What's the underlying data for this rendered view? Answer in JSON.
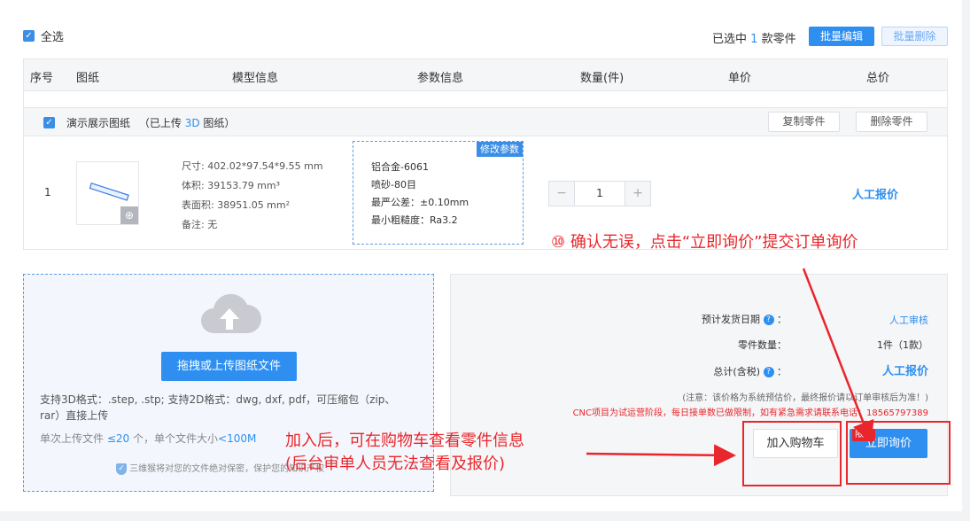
{
  "toolbar": {
    "select_all": "全选",
    "selected_prefix": "已选中",
    "selected_count": "1",
    "selected_suffix": "款零件",
    "batch_edit": "批量编辑",
    "batch_delete": "批量删除"
  },
  "table": {
    "headers": [
      "序号",
      "图纸",
      "模型信息",
      "参数信息",
      "数量(件)",
      "单价",
      "总价"
    ]
  },
  "group": {
    "name": "演示展示图纸",
    "uploaded_prefix": "（已上传",
    "uploaded_count": "3D",
    "uploaded_suffix": "图纸）",
    "copy_part": "复制零件",
    "delete_part": "删除零件"
  },
  "part": {
    "index": "1",
    "size": "尺寸: 402.02*97.54*9.55 mm",
    "volume": "体积: 39153.79 mm³",
    "area": "表面积: 38951.05 mm²",
    "note": "备注: 无",
    "edit_params": "修改参数",
    "material": "铝合金-6061",
    "finish": "喷砂-80目",
    "tolerance": "最严公差：±0.10mm",
    "roughness": "最小粗糙度：Ra3.2",
    "quantity": "1",
    "minus": "−",
    "plus": "+",
    "price": "人工报价"
  },
  "upload": {
    "button": "拖拽或上传图纸文件",
    "formats_line1": "支持3D格式：.step, .stp; 支持2D格式：dwg, dxf, pdf，可压缩包（zip、",
    "formats_line2": "rar）直接上传",
    "limit_prefix": "单次上传文件",
    "limit_count": "≤20",
    "limit_mid": "个，单个文件大小",
    "limit_size": "<100M",
    "security": "三维猴将对您的文件绝对保密，保护您的知识产权"
  },
  "summary": {
    "delivery_label": "预计发货日期",
    "delivery_value": "人工审核",
    "count_label": "零件数量：",
    "count_value": "1件（1款）",
    "total_label": "总计(含税)",
    "total_value": "人工报价",
    "colon": "：",
    "notice": "(注意：该价格为系统预估价，最终报价请以订单审核后为准！)",
    "cnc_notice": "CNC项目为试运营阶段，每日接单数已做限制，如有紧急需求请联系电话：18565797389",
    "add_cart": "加入购物车",
    "inquire": "立即询价",
    "limited_tag": "限单"
  },
  "annotations": {
    "step10": "⑩ 确认无误，点击“立即询价”提交订单询价",
    "cart_line1": "加入后，可在购物车查看零件信息",
    "cart_line2": "(后台审单人员无法查看及报价)"
  }
}
